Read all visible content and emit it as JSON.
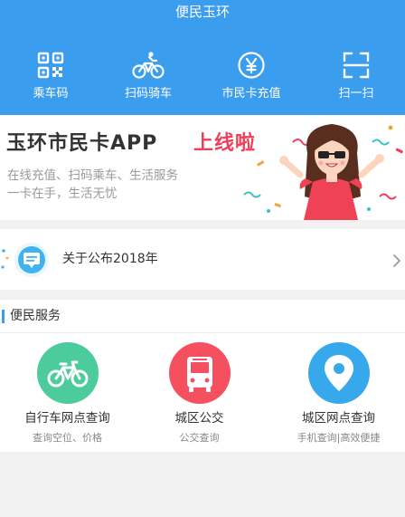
{
  "header": {
    "title": "便民玉环",
    "background": "#3b9ded",
    "quick_actions": [
      {
        "label": "乘车码",
        "icon": "qr-code-icon"
      },
      {
        "label": "扫码骑车",
        "icon": "bicycle-rider-icon"
      },
      {
        "label": "市民卡充值",
        "icon": "yen-icon"
      },
      {
        "label": "扫一扫",
        "icon": "scan-icon"
      }
    ]
  },
  "banner": {
    "title": "玉环市民卡APP",
    "title_highlight": "上线啦",
    "subtitle_1": "在线充值、扫码乘车、生活服务",
    "subtitle_2": "一卡在手，生活无忧",
    "highlight_color": "#f23d5a"
  },
  "notice": {
    "text": "关于公布2018年",
    "icon": "message-icon"
  },
  "services": {
    "title": "便民服务",
    "items": [
      {
        "name": "自行车网点查询",
        "desc": "查询空位、价格",
        "icon": "bicycle-icon",
        "color": "#4ccb9c"
      },
      {
        "name": "城区公交",
        "desc": "公交查询",
        "icon": "bus-icon",
        "color": "#f4505f"
      },
      {
        "name": "城区网点查询",
        "desc": "手机查询|高效便捷",
        "icon": "location-pin-icon",
        "color": "#38a8ec"
      }
    ]
  }
}
